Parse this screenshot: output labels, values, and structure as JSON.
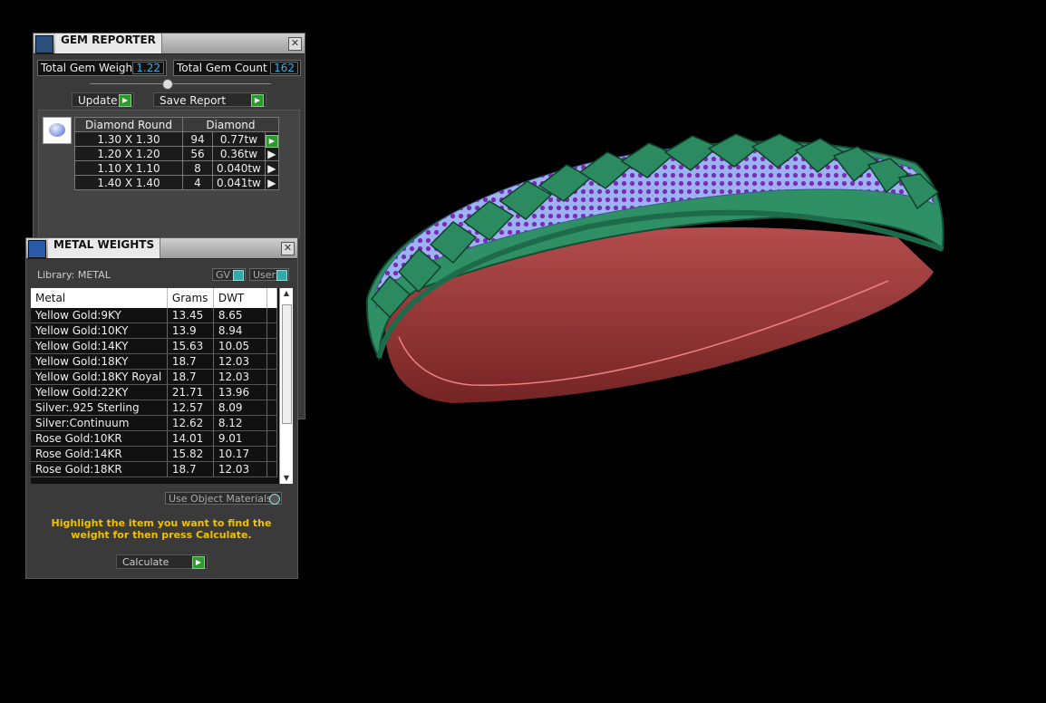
{
  "gem_reporter": {
    "title": "GEM REPORTER",
    "total_weight_label": "Total Gem Weight",
    "total_weight_value": "1.22",
    "total_count_label": "Total Gem Count",
    "total_count_value": "162",
    "update_label": "Update",
    "save_report_label": "Save Report",
    "table": {
      "shape_header": "Diamond Round",
      "material_header": "Diamond",
      "rows": [
        {
          "size": "1.30 X 1.30",
          "count": "94",
          "weight": "0.77tw"
        },
        {
          "size": "1.20 X 1.20",
          "count": "56",
          "weight": "0.36tw"
        },
        {
          "size": "1.10 X 1.10",
          "count": "8",
          "weight": "0.040tw"
        },
        {
          "size": "1.40 X 1.40",
          "count": "4",
          "weight": "0.041tw"
        }
      ]
    }
  },
  "metal_weights": {
    "title": "METAL WEIGHTS",
    "library_label": "Library: METAL",
    "gv_label": "GV",
    "user_label": "User",
    "columns": [
      "Metal",
      "Grams",
      "DWT"
    ],
    "rows": [
      {
        "metal": "Yellow Gold:9KY",
        "grams": "13.45",
        "dwt": "8.65"
      },
      {
        "metal": "Yellow Gold:10KY",
        "grams": "13.9",
        "dwt": "8.94"
      },
      {
        "metal": "Yellow Gold:14KY",
        "grams": "15.63",
        "dwt": "10.05"
      },
      {
        "metal": "Yellow Gold:18KY",
        "grams": "18.7",
        "dwt": "12.03"
      },
      {
        "metal": "Yellow Gold:18KY Royal",
        "grams": "18.7",
        "dwt": "12.03"
      },
      {
        "metal": "Yellow Gold:22KY",
        "grams": "21.71",
        "dwt": "13.96"
      },
      {
        "metal": "Silver:.925 Sterling",
        "grams": "12.57",
        "dwt": "8.09"
      },
      {
        "metal": "Silver:Continuum",
        "grams": "12.62",
        "dwt": "8.12"
      },
      {
        "metal": "Rose Gold:10KR",
        "grams": "14.01",
        "dwt": "9.01"
      },
      {
        "metal": "Rose Gold:14KR",
        "grams": "15.82",
        "dwt": "10.17"
      },
      {
        "metal": "Rose Gold:18KR",
        "grams": "18.7",
        "dwt": "12.03"
      }
    ],
    "use_object_materials_label": "Use Object Materials",
    "hint_text": "Highlight the item you want to find the weight for then press Calculate.",
    "calculate_label": "Calculate"
  },
  "colors": {
    "bracelet_metal": "#2f8f65",
    "gems_blue": "#9ab0f0",
    "gems_purple": "#7a1fb0",
    "inner_band": "#b84545"
  }
}
